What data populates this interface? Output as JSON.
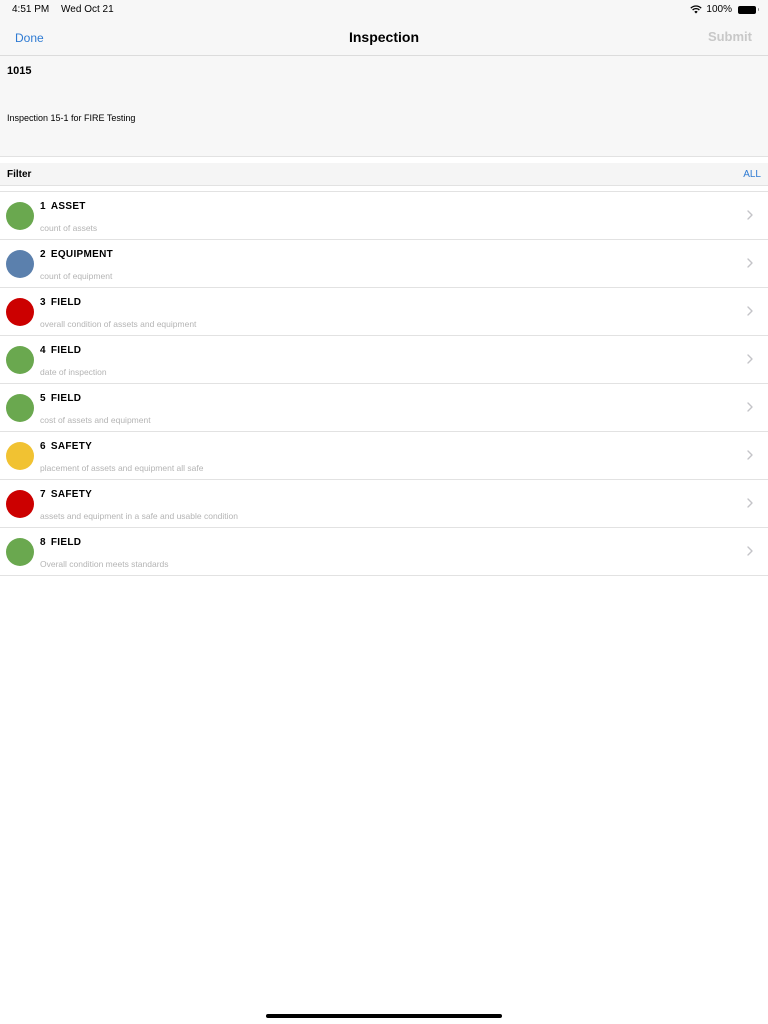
{
  "status_bar": {
    "time": "4:51 PM",
    "date": "Wed Oct 21",
    "battery": "100%",
    "wifi_icon": "wifi-icon",
    "battery_icon": "battery-icon"
  },
  "nav": {
    "done_label": "Done",
    "title": "Inspection",
    "submit_label": "Submit"
  },
  "info": {
    "id": "1015",
    "description": "Inspection 15-1 for FIRE Testing"
  },
  "filter": {
    "label": "Filter",
    "all_label": "ALL"
  },
  "colors": {
    "green": "#6aa84f",
    "blue": "#5b80ad",
    "red": "#cc0000",
    "yellow": "#f1c232",
    "accent": "#2f7bd3"
  },
  "items": [
    {
      "number": "1",
      "category": "ASSET",
      "subtitle": "count of assets",
      "status_color": "#6aa84f"
    },
    {
      "number": "2",
      "category": "EQUIPMENT",
      "subtitle": "count of equipment",
      "status_color": "#5b80ad"
    },
    {
      "number": "3",
      "category": "FIELD",
      "subtitle": "overall condition of assets and equipment",
      "status_color": "#cc0000"
    },
    {
      "number": "4",
      "category": "FIELD",
      "subtitle": "date of inspection",
      "status_color": "#6aa84f"
    },
    {
      "number": "5",
      "category": "FIELD",
      "subtitle": "cost of assets and equipment",
      "status_color": "#6aa84f"
    },
    {
      "number": "6",
      "category": "SAFETY",
      "subtitle": "placement of assets and equipment all safe",
      "status_color": "#f1c232"
    },
    {
      "number": "7",
      "category": "SAFETY",
      "subtitle": "assets and equipment in a safe and usable condition",
      "status_color": "#cc0000"
    },
    {
      "number": "8",
      "category": "FIELD",
      "subtitle": "Overall condition meets standards",
      "status_color": "#6aa84f"
    }
  ]
}
